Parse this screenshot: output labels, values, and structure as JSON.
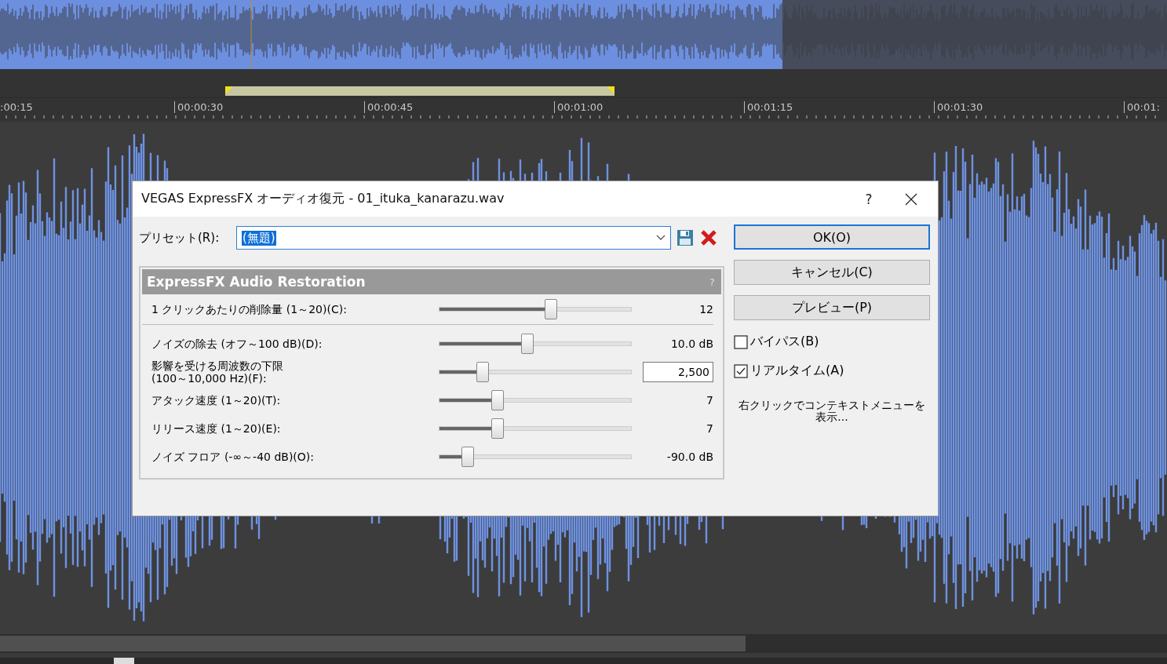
{
  "timeline": {
    "ruler_labels": [
      ":00:15",
      "00:00:30",
      "00:00:45",
      "00:01:00",
      "00:01:15",
      "00:01:30",
      "00:01:"
    ]
  },
  "dialog": {
    "title": "VEGAS ExpressFX オーディオ復元 - 01_ituka_kanarazu.wav",
    "help": "?",
    "preset": {
      "label": "プリセット(R):",
      "value": "(無題)"
    },
    "panel": {
      "title": "ExpressFX Audio Restoration",
      "help": "?",
      "params": [
        {
          "kind": "value",
          "label": "1 クリックあたりの削除量 (1～20)(C):",
          "level": 0.577,
          "reading": "12"
        },
        {
          "kind": "value",
          "label": "ノイズの除去 (オフ～100 dB)(D):",
          "level": 0.463,
          "reading": "10.0 dB"
        },
        {
          "kind": "field",
          "label": "影響を受ける周波数の下限\n(100～10,000 Hz)(F):",
          "level": 0.244,
          "reading": "2,500"
        },
        {
          "kind": "value",
          "label": "アタック速度 (1～20)(T):",
          "level": 0.317,
          "reading": "7"
        },
        {
          "kind": "value",
          "label": "リリース速度 (1～20)(E):",
          "level": 0.317,
          "reading": "7"
        },
        {
          "kind": "value",
          "label": "ノイズ フロア (-∞～-40 dB)(O):",
          "level": 0.171,
          "reading": "-90.0 dB"
        }
      ]
    },
    "buttons": [
      {
        "label": "OK(O)",
        "default": true
      },
      {
        "label": "キャンセル(C)",
        "default": false
      },
      {
        "label": "プレビュー(P)",
        "default": false
      }
    ],
    "checkboxes": [
      {
        "label": "バイパス(B)",
        "checked": false
      },
      {
        "label": "リアルタイム(A)",
        "checked": true
      }
    ],
    "hint": "右クリックでコンテキストメニューを表示..."
  }
}
